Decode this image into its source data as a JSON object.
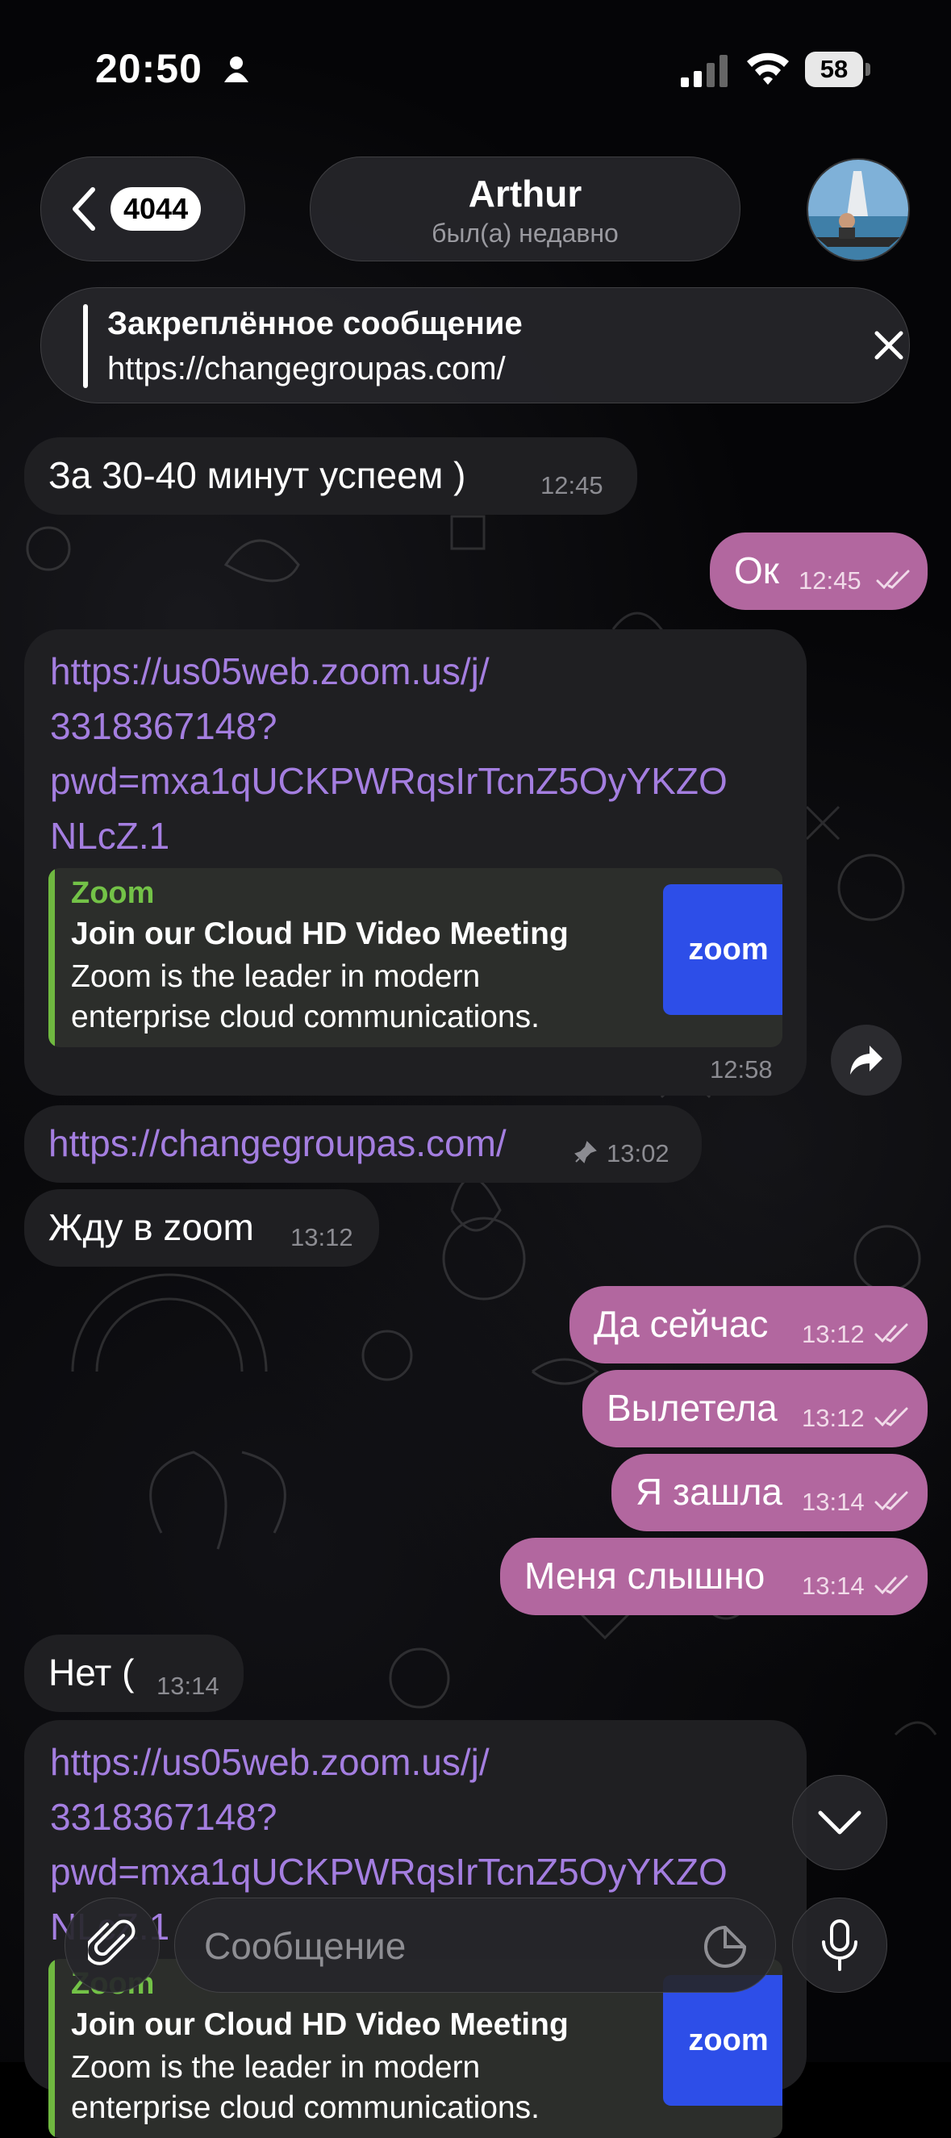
{
  "status_bar": {
    "time": "20:50",
    "battery": "58"
  },
  "header": {
    "back_count": "4044",
    "contact_name": "Arthur",
    "contact_status": "был(а) недавно"
  },
  "pinned": {
    "title": "Закреплённое сообщение",
    "text": "https://changegroupas.com/"
  },
  "messages": [
    {
      "dir": "in",
      "text": "За 30-40 минут успеем )",
      "time": "12:45"
    },
    {
      "dir": "out",
      "text": "Ок",
      "time": "12:45"
    },
    {
      "dir": "in",
      "type": "link",
      "url_lines": [
        "https://us05web.zoom.us/j/",
        "3318367148?",
        "pwd=mxa1qUCKPWRqsIrTcnZ5OyYKZO",
        "NLcZ.1"
      ],
      "preview": {
        "site": "Zoom",
        "title": "Join our Cloud HD Video Meeting",
        "desc_lines": [
          "Zoom is the leader in modern",
          "enterprise cloud communications."
        ],
        "logo": "zoom"
      },
      "time": "12:58"
    },
    {
      "dir": "in",
      "text": "https://changegroupas.com/",
      "time": "13:02",
      "pinned": true
    },
    {
      "dir": "in",
      "text": "Жду в zoom",
      "time": "13:12"
    },
    {
      "dir": "out",
      "text": "Да сейчас",
      "time": "13:12"
    },
    {
      "dir": "out",
      "text": "Вылетела",
      "time": "13:12"
    },
    {
      "dir": "out",
      "text": "Я зашла",
      "time": "13:14"
    },
    {
      "dir": "out",
      "text": "Меня слышно",
      "time": "13:14"
    },
    {
      "dir": "in",
      "text": "Нет (",
      "time": "13:14"
    },
    {
      "dir": "in",
      "type": "link",
      "url_lines": [
        "https://us05web.zoom.us/j/",
        "3318367148?",
        "pwd=mxa1qUCKPWRqsIrTcnZ5OyYKZO",
        "NLcZ.1"
      ],
      "preview": {
        "site": "Zoom",
        "title": "Join our Cloud HD Video Meeting",
        "desc_lines": [
          "Zoom is the leader in modern",
          "enterprise cloud communications."
        ],
        "logo": "zoom"
      }
    }
  ],
  "input": {
    "placeholder": "Сообщение"
  },
  "icons": {
    "back": "chevron-left-icon",
    "pinned_close": "close-icon",
    "share": "share-arrow-icon",
    "scroll_down": "chevron-down-icon",
    "attach": "paperclip-icon",
    "sticker": "sticker-icon",
    "mic": "microphone-icon",
    "read": "double-check-icon",
    "pin": "pin-icon"
  },
  "colors": {
    "outgoing_bubble": "#b2679f",
    "incoming_bubble": "#1f1f22",
    "link": "#a47ee0",
    "preview_accent": "#6fb840",
    "zoom_logo_bg": "#2d4ee8"
  }
}
